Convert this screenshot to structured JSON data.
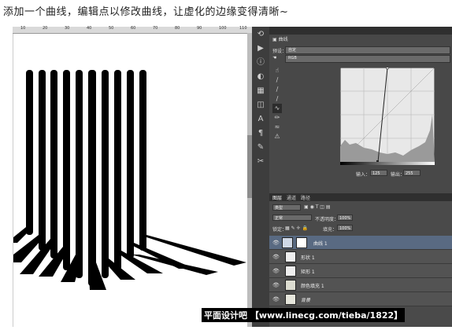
{
  "caption": "添加一个曲线，编辑点以修改曲线，让虚化的边缘变得清晰~",
  "ruler": {
    "ticks": [
      "10",
      "20",
      "30",
      "40",
      "50",
      "60",
      "70",
      "80",
      "90",
      "100",
      "110"
    ]
  },
  "properties": {
    "title": "曲线",
    "preset_label": "预设：",
    "preset_value": "自定",
    "channel_value": "RGB",
    "input_label": "输入：",
    "input_value": "125",
    "output_label": "输出：",
    "output_value": "255"
  },
  "toolbar": {
    "icons": [
      "history-icon",
      "actions-icon",
      "info-icon",
      "adjust-icon",
      "swatches-icon",
      "styles-icon",
      "character-icon",
      "paragraph-icon",
      "brush-icon",
      "tools-icon"
    ]
  },
  "curve_tools": [
    "on-image-adjust-icon",
    "eyedropper-black-icon",
    "eyedropper-gray-icon",
    "eyedropper-white-icon",
    "curve-edit-icon",
    "pencil-icon",
    "smooth-icon",
    "warning-icon"
  ],
  "layers_panel": {
    "tabs": [
      "图层",
      "通道",
      "路径"
    ],
    "kind_label": "类型",
    "blend_mode": "正常",
    "opacity_label": "不透明度：",
    "opacity_value": "100%",
    "lock_label": "锁定：",
    "fill_label": "填充：",
    "fill_value": "100%",
    "layers": [
      {
        "name": "曲线 1",
        "selected": true
      },
      {
        "name": "形状 1",
        "selected": false
      },
      {
        "name": "矩形 1",
        "selected": false
      },
      {
        "name": "颜色填充 1",
        "selected": false
      },
      {
        "name": "背景",
        "selected": false
      }
    ]
  },
  "watermark": "平面设计吧 【www.linecg.com/tieba/1822】",
  "colors": {
    "panel_bg": "#535353",
    "selected_layer": "#596a82",
    "shape": "#000000"
  }
}
